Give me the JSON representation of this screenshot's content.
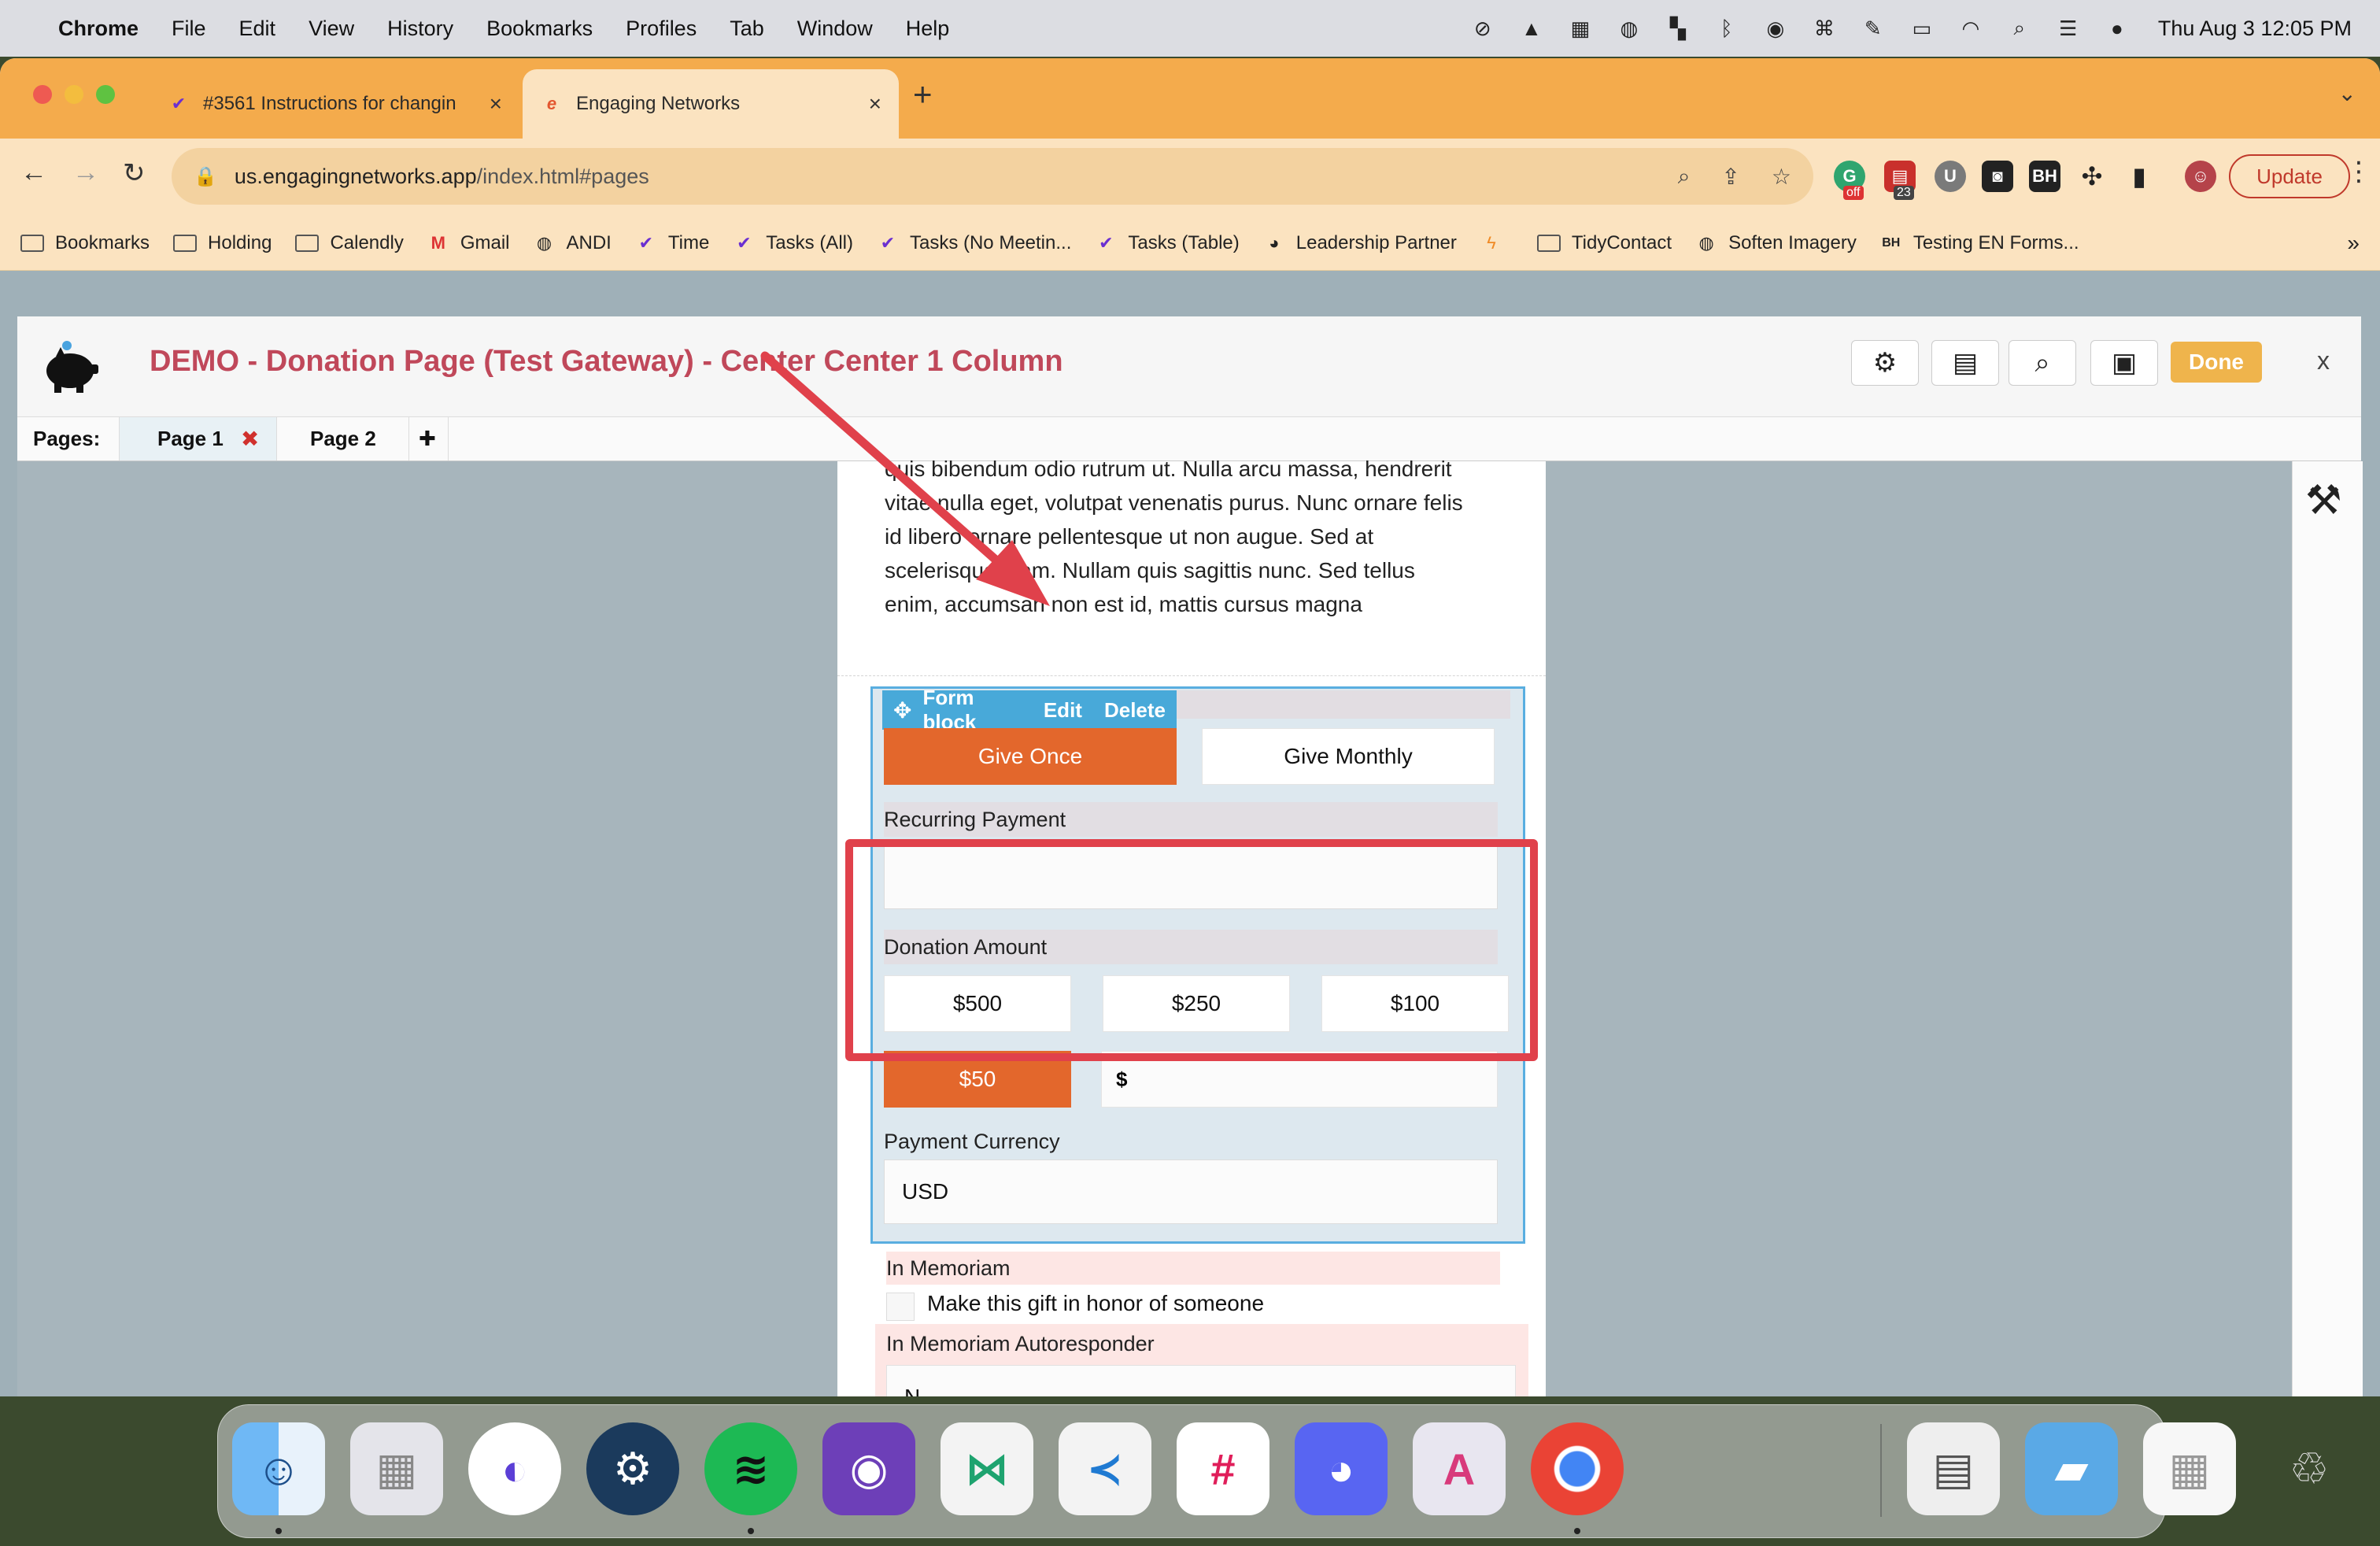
{
  "menubar": {
    "app": "Chrome",
    "menus": [
      "File",
      "Edit",
      "View",
      "History",
      "Bookmarks",
      "Profiles",
      "Tab",
      "Window",
      "Help"
    ],
    "clock": "Thu Aug 3  12:05 PM"
  },
  "browser": {
    "tabs": [
      {
        "title": "#3561 Instructions for changin",
        "active": false
      },
      {
        "title": "Engaging Networks",
        "active": true
      }
    ],
    "url_host": "us.engagingnetworks.app",
    "url_path": "/index.html#pages",
    "update_label": "Update",
    "extension_badge": "23",
    "extension_off": "off",
    "bookmarks": [
      "Bookmarks",
      "Holding",
      "Calendly",
      "Gmail",
      "ANDI",
      "Time",
      "Tasks (All)",
      "Tasks (No Meetin...",
      "Tasks (Table)",
      "Leadership Partner",
      "",
      "TidyContact",
      "Soften Imagery",
      "Testing EN Forms..."
    ],
    "bookmarks_more": "»"
  },
  "editor": {
    "title": "DEMO - Donation Page (Test Gateway) - Center Center 1 Column",
    "done_label": "Done",
    "close_label": "x",
    "pages_label": "Pages:",
    "pages": [
      "Page 1",
      "Page 2"
    ],
    "add_page": "✚"
  },
  "form": {
    "lorem_lines": [
      "quis bibendum odio rutrum ut. Nulla arcu massa, hendrerit",
      "vitae nulla eget, volutpat venenatis purus. Nunc ornare felis",
      "id libero ornare pellentesque ut non augue. Sed at",
      "scelerisque diam. Nullam quis sagittis nunc. Sed tellus",
      "enim, accumsan non est id, mattis cursus magna"
    ],
    "block_toolbar": {
      "name": "Form block",
      "edit": "Edit",
      "delete": "Delete"
    },
    "give_once": "Give Once",
    "give_monthly": "Give Monthly",
    "recurring_label": "Recurring Payment",
    "recurring_value": "",
    "donation_label": "Donation Amount",
    "amounts": [
      "$500",
      "$250",
      "$100",
      "$50"
    ],
    "selected_amount": "$50",
    "other_prefix": "$",
    "currency_label": "Payment Currency",
    "currency_value": "USD",
    "memoriam_label": "In Memoriam",
    "memoriam_checkbox": "Make this gift in honor of someone",
    "autoresponder_label": "In Memoriam Autoresponder",
    "autoresponder_value": "N"
  },
  "dock": {
    "apps": [
      "finder-icon",
      "launchpad-icon",
      "notion-calendar-icon",
      "steam-icon",
      "spotify-icon",
      "github-desktop-icon",
      "visual-studio-icon",
      "vscode-icon",
      "slack-icon",
      "discord-icon",
      "affinity-icon",
      "chrome-icon",
      "preview-icon",
      "folder-icon",
      "screenshot-icon",
      "trash-icon"
    ]
  },
  "colors": {
    "tab_bar": "#f4ab4c",
    "toolbar": "#fbe3c0",
    "title_red": "#c0485a",
    "accent_orange": "#e3672c",
    "block_blue": "#48a9d9",
    "highlight_red": "#e0414b",
    "done_button": "#efb44c"
  }
}
